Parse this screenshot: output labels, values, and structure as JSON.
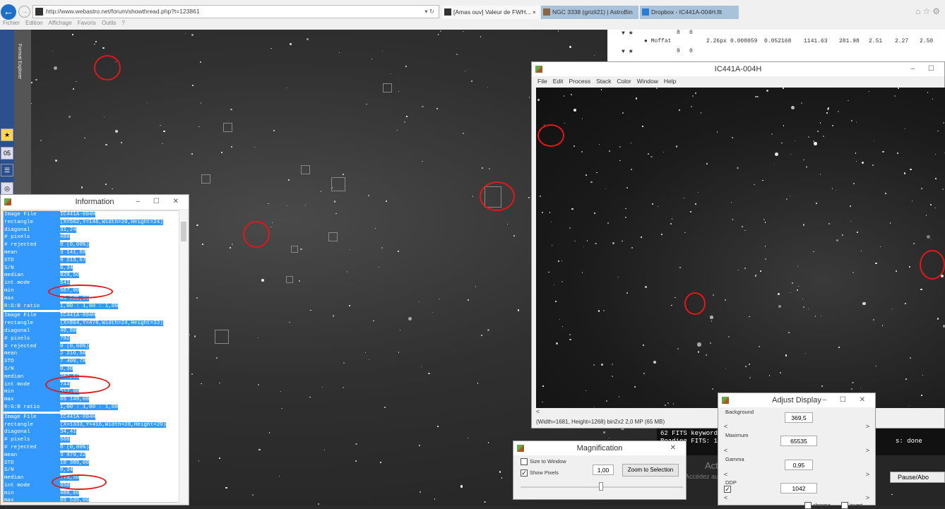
{
  "browser": {
    "url": "http://www.webastro.net/forum/showthread.php?t=123861",
    "tabs": [
      {
        "label": "[Amas ouv] Valeur de FWH...",
        "close": "×"
      },
      {
        "label": "NGC 3338 (grizli21) | AstroBin"
      },
      {
        "label": "Dropbox - IC441A-004H.fit"
      }
    ],
    "menu": [
      "Fichier",
      "Edition",
      "Affichage",
      "Favoris",
      "Outils",
      "?"
    ],
    "sidebar_text": "Format Explorer",
    "calendar": "05"
  },
  "table": {
    "rows": [
      {
        "id": "8",
        "col": "0"
      },
      {
        "model": "Moffat",
        "values": [
          "2.26px",
          "0.008059",
          "0.052168",
          "1141.63",
          "281.98",
          "2.51",
          "2.27",
          "2.50"
        ]
      },
      {
        "id": "9",
        "col": "0"
      }
    ]
  },
  "info": {
    "title": "Information",
    "blocks": [
      {
        "rows": [
          [
            "Image File",
            "IC441A-004H"
          ],
          [
            "  rectangle",
            "(X=562,Y=146,Width=20,Height=24)"
          ],
          [
            "  diagonal",
            "31,24"
          ],
          [
            "  # pixels",
            "480"
          ],
          [
            "  # rejected",
            "0 (0,00%)"
          ],
          [
            "  mean",
            "3 141,69"
          ],
          [
            "  STD",
            "9 215,67"
          ],
          [
            "  S/N",
            "0,34"
          ],
          [
            "  median",
            "829,50"
          ],
          [
            "  int mode",
            "641"
          ],
          [
            "  min",
            "567,00"
          ],
          [
            "  max",
            "65 535,00"
          ],
          [
            "  R:G:B ratio",
            "1,00 : 1,00 : 1,00"
          ]
        ]
      },
      {
        "rows": [
          [
            "Image File",
            "IC441A-004H"
          ],
          [
            "  rectangle",
            "(X=864,Y=478,Width=24,Height=33)"
          ],
          [
            "  diagonal",
            "40,80"
          ],
          [
            "  # pixels",
            "792"
          ],
          [
            "  # rejected",
            "0 (0,00%)"
          ],
          [
            "  mean",
            "2 216,56"
          ],
          [
            "  STD",
            "7 400,78"
          ],
          [
            "  S/N",
            "0,30"
          ],
          [
            "  median",
            "767,50"
          ],
          [
            "  int mode",
            "744"
          ],
          [
            "  min",
            "517,00"
          ],
          [
            "  max",
            "65 149,00"
          ],
          [
            "  R:G:B ratio",
            "1,00 : 1,00 : 1,00"
          ]
        ]
      },
      {
        "rows": [
          [
            "Image File",
            "IC441A-004H"
          ],
          [
            "  rectangle",
            "(X=1333,Y=416,Width=28,Height=20)"
          ],
          [
            "  diagonal",
            "34,41"
          ],
          [
            "  # pixels",
            "560"
          ],
          [
            "  # rejected",
            "0 (0,00%)"
          ],
          [
            "  mean",
            "3 479,22"
          ],
          [
            "  STD",
            "10 385,00"
          ],
          [
            "  S/N",
            "0,34"
          ],
          [
            "  median",
            "775,50"
          ],
          [
            "  int mode",
            "656"
          ],
          [
            "  min",
            "488,00"
          ],
          [
            "  max",
            "65 535,00"
          ],
          [
            "  R:G:B ratio",
            "1,00 : 1,00 : 1,00"
          ]
        ]
      }
    ]
  },
  "fits": {
    "title": "IC441A-004H",
    "menu": [
      "File",
      "Edit",
      "Process",
      "Stack",
      "Color",
      "Window",
      "Help"
    ],
    "status": "(Width=1681, Height=1268) bin2x2  2,0 MP (65 MB)"
  },
  "terminal": {
    "line1": "62 FITS keywords",
    "line2": "Reading FITS: 16",
    "line2_end": "s: done"
  },
  "magnification": {
    "title": "Magnification",
    "size_to_window": "Size to Window",
    "show_pixels": "Show Pixels",
    "value": "1,00",
    "zoom_button": "Zoom to Selection",
    "slider": 0.5
  },
  "adjust": {
    "title": "Adjust Display",
    "background_label": "Background",
    "background": "369,5",
    "maximum_label": "Maximum",
    "maximum": "65535",
    "gamma_label": "Gamma",
    "gamma": "0,95",
    "ddp_label": "DDP",
    "ddp": "1042",
    "chroma": "chroma",
    "invert": "invert"
  },
  "overlay": {
    "activate": "Activer Windows",
    "activate_sub": "Accédez aux paramètres de l'ordinateur pour activer Windows",
    "pause": "Pause/Abo"
  }
}
